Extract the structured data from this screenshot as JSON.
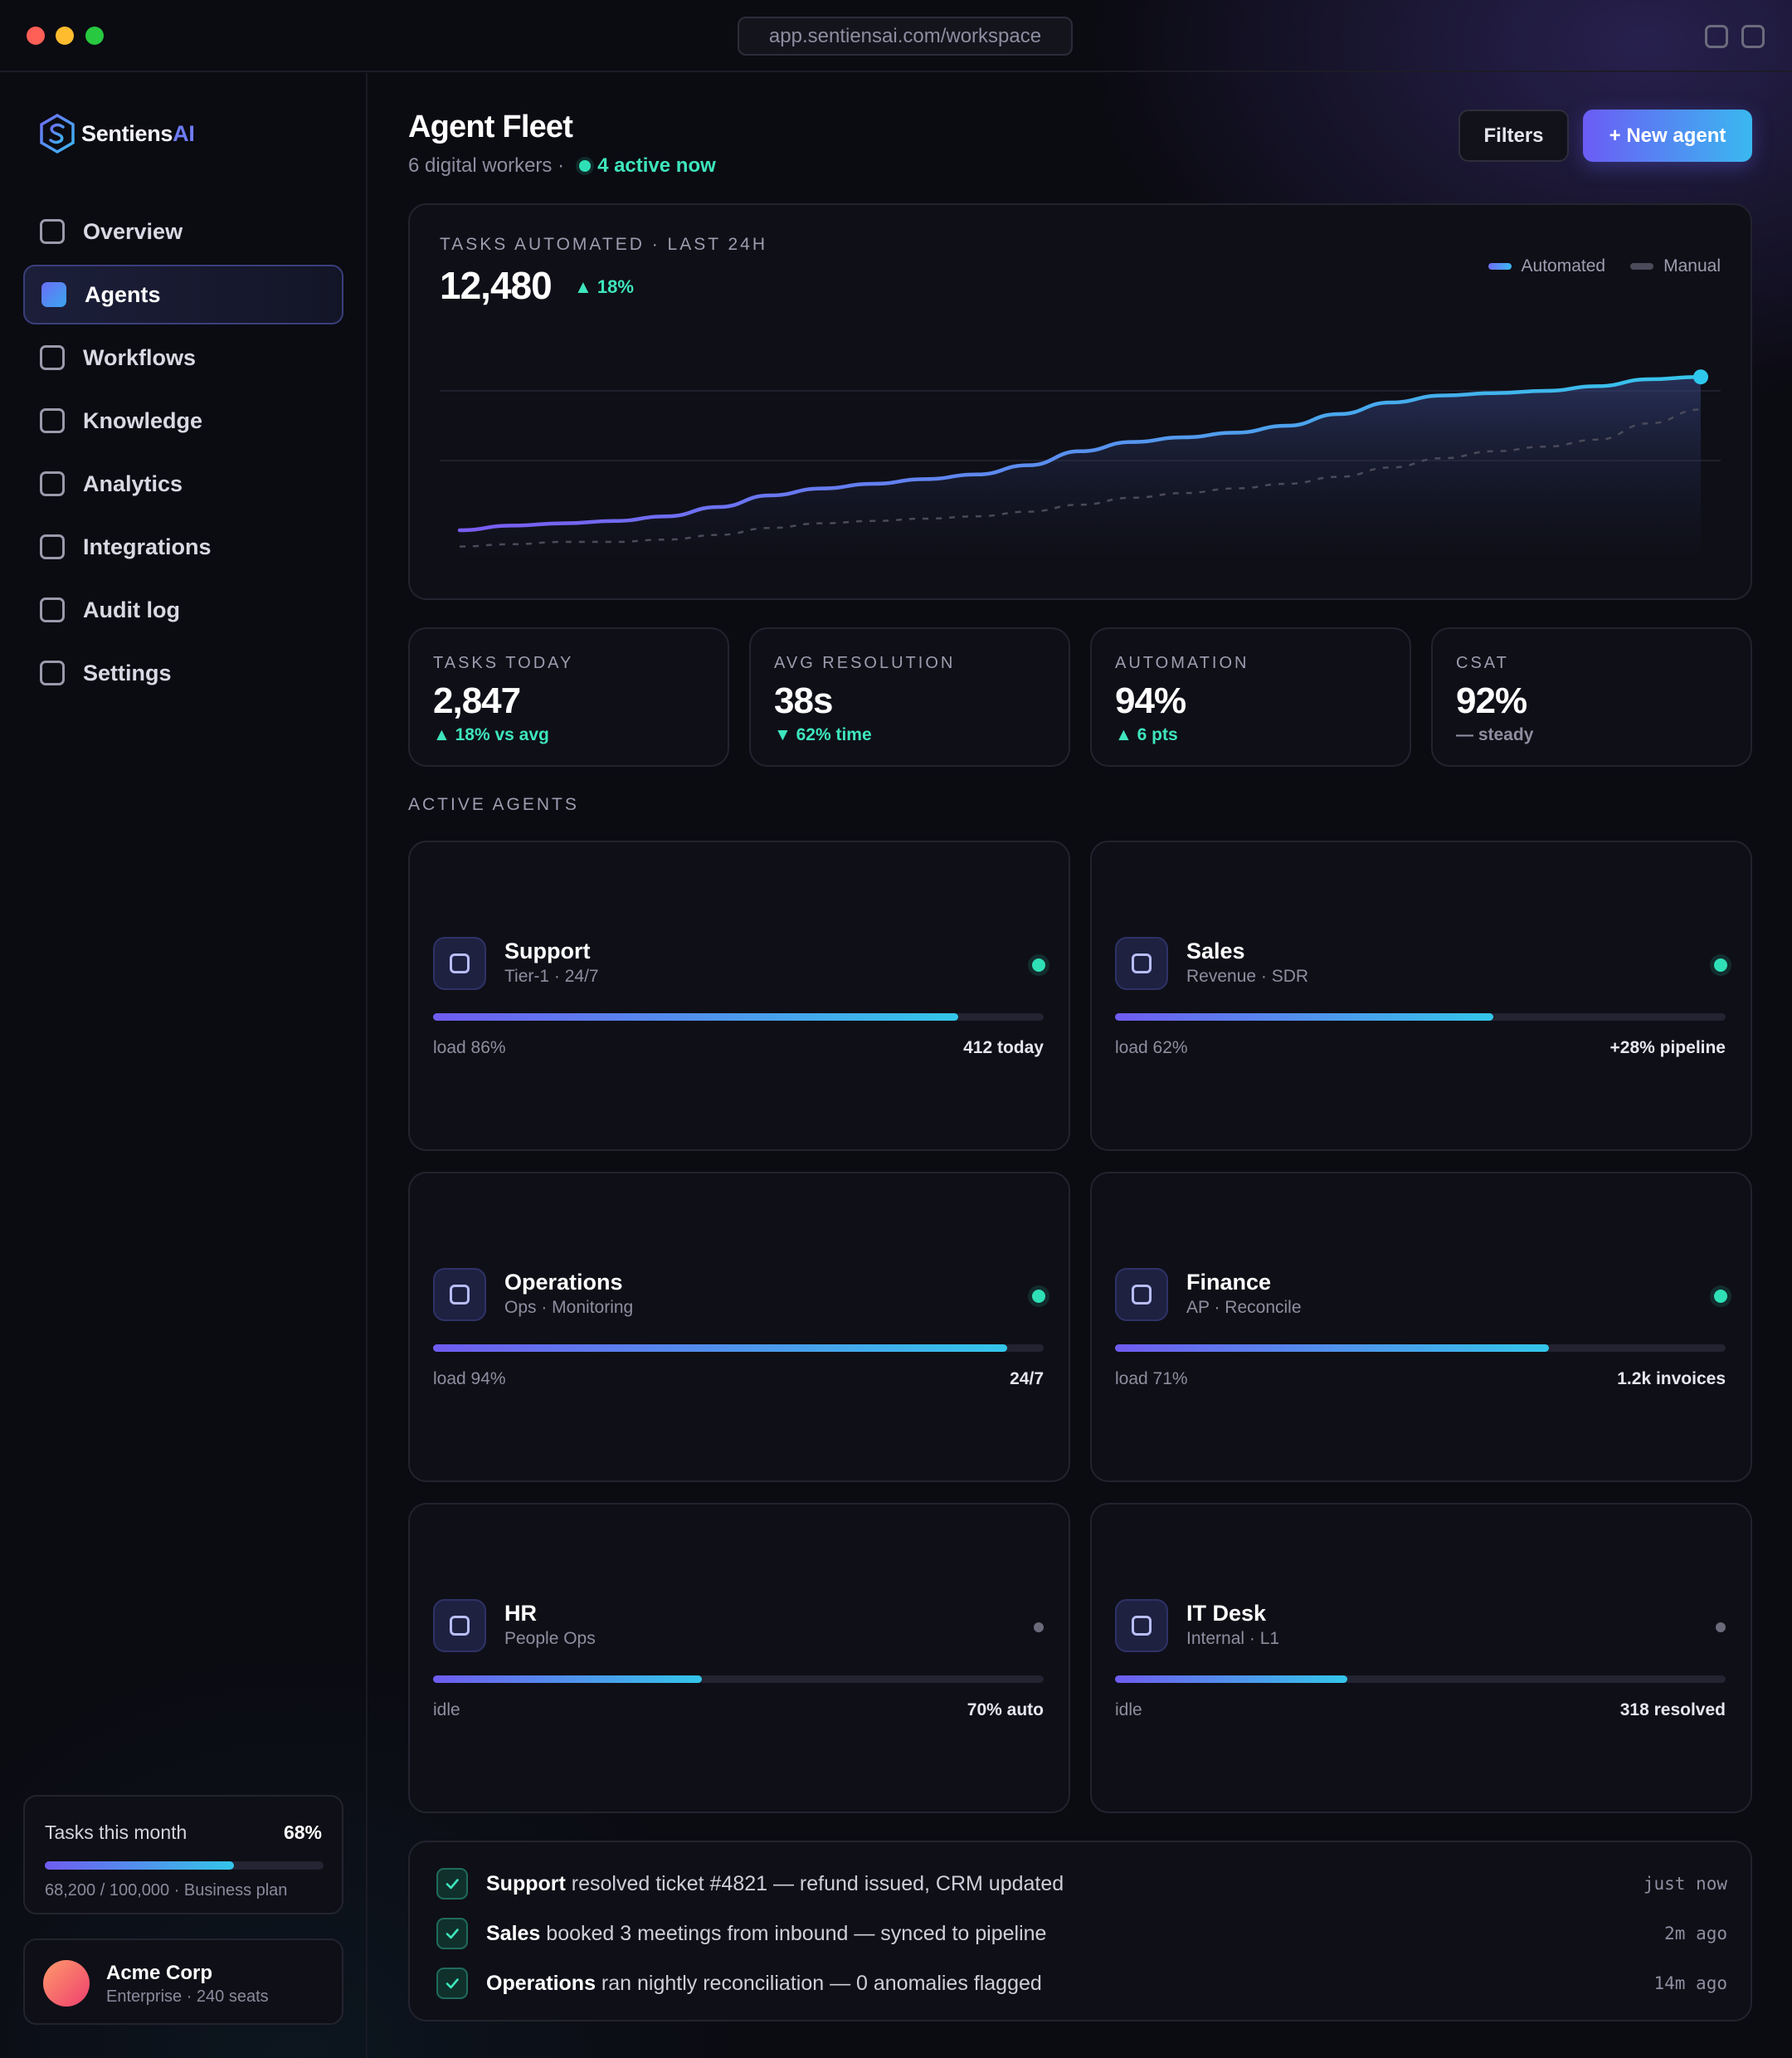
{
  "window": {
    "url": "app.sentiensai.com/workspace"
  },
  "brand": {
    "name_main": "Sentiens",
    "name_accent": "AI"
  },
  "sidebar": {
    "items": [
      {
        "label": "Overview",
        "active": false
      },
      {
        "label": "Agents",
        "active": true
      },
      {
        "label": "Workflows",
        "active": false
      },
      {
        "label": "Knowledge",
        "active": false
      },
      {
        "label": "Analytics",
        "active": false
      },
      {
        "label": "Integrations",
        "active": false
      },
      {
        "label": "Audit log",
        "active": false
      },
      {
        "label": "Settings",
        "active": false
      }
    ],
    "quota": {
      "label": "Tasks this month",
      "percent_label": "68%",
      "percent": 68,
      "detail": "68,200 / 100,000 · Business plan"
    },
    "account": {
      "name": "Acme Corp",
      "detail": "Enterprise · 240 seats"
    }
  },
  "header": {
    "title": "Agent Fleet",
    "subtitle": "6 digital workers ·",
    "active_label": "4 active now",
    "filters_label": "Filters",
    "new_agent_label": "+ New agent"
  },
  "chart_panel": {
    "eyebrow": "TASKS AUTOMATED · LAST 24H",
    "total": "12,480",
    "delta": "▲ 18%",
    "legend": [
      "Automated",
      "Manual"
    ]
  },
  "chart_data": {
    "type": "area",
    "title": "TASKS AUTOMATED · LAST 24H",
    "x": [
      0,
      1,
      2,
      3,
      4,
      5,
      6,
      7,
      8,
      9,
      10,
      11,
      12,
      13,
      14,
      15,
      16,
      17,
      18,
      19,
      20,
      21,
      22,
      23,
      24
    ],
    "ylim": [
      0,
      100
    ],
    "grid": true,
    "legend_position": "top-right",
    "series": [
      {
        "name": "Automated",
        "color": "#6f6ef5",
        "values": [
          10,
          12,
          13,
          14,
          16,
          20,
          25,
          28,
          30,
          32,
          34,
          38,
          44,
          48,
          50,
          52,
          55,
          60,
          65,
          68,
          69,
          70,
          72,
          75,
          76
        ]
      },
      {
        "name": "Manual",
        "color": "#4a4a5a",
        "dashed": true,
        "values": [
          3,
          4,
          5,
          5,
          6,
          8,
          11,
          13,
          14,
          15,
          16,
          18,
          21,
          24,
          26,
          28,
          30,
          33,
          37,
          41,
          44,
          46,
          49,
          56,
          62
        ]
      }
    ]
  },
  "stats": [
    {
      "label": "TASKS TODAY",
      "value": "2,847",
      "delta": "▲ 18% vs avg",
      "tone": "up"
    },
    {
      "label": "AVG RESOLUTION",
      "value": "38s",
      "delta": "▼ 62% time",
      "tone": "up"
    },
    {
      "label": "AUTOMATION",
      "value": "94%",
      "delta": "▲ 6 pts",
      "tone": "up"
    },
    {
      "label": "CSAT",
      "value": "92%",
      "delta": "— steady",
      "tone": "neutral"
    }
  ],
  "section": {
    "active_agents": "ACTIVE AGENTS"
  },
  "agents": [
    {
      "name": "Support",
      "sub": "Tier-1 · 24/7",
      "status": "active",
      "load_label": "load 86%",
      "load": 86,
      "metric": "412 today"
    },
    {
      "name": "Sales",
      "sub": "Revenue · SDR",
      "status": "active",
      "load_label": "load 62%",
      "load": 62,
      "metric": "+28% pipeline"
    },
    {
      "name": "Operations",
      "sub": "Ops · Monitoring",
      "status": "active",
      "load_label": "load 94%",
      "load": 94,
      "metric": "24/7"
    },
    {
      "name": "Finance",
      "sub": "AP · Reconcile",
      "status": "active",
      "load_label": "load 71%",
      "load": 71,
      "metric": "1.2k invoices"
    },
    {
      "name": "HR",
      "sub": "People Ops",
      "status": "idle",
      "load_label": "idle",
      "load": 44,
      "metric": "70% auto"
    },
    {
      "name": "IT Desk",
      "sub": "Internal · L1",
      "status": "idle",
      "load_label": "idle",
      "load": 38,
      "metric": "318 resolved"
    }
  ],
  "activity": [
    {
      "agent": "Support",
      "text": " resolved ticket #4821 — refund issued, CRM updated",
      "time": "just now"
    },
    {
      "agent": "Sales",
      "text": " booked 3 meetings from inbound — synced to pipeline",
      "time": "2m ago"
    },
    {
      "agent": "Operations",
      "text": " ran nightly reconciliation — 0 anomalies flagged",
      "time": "14m ago"
    }
  ],
  "colors": {
    "accent": "#6b5cf5",
    "accent2": "#3ab8f0",
    "positive": "#3ee6bd",
    "background": "#0b0b12",
    "card": "#0f0f17"
  }
}
